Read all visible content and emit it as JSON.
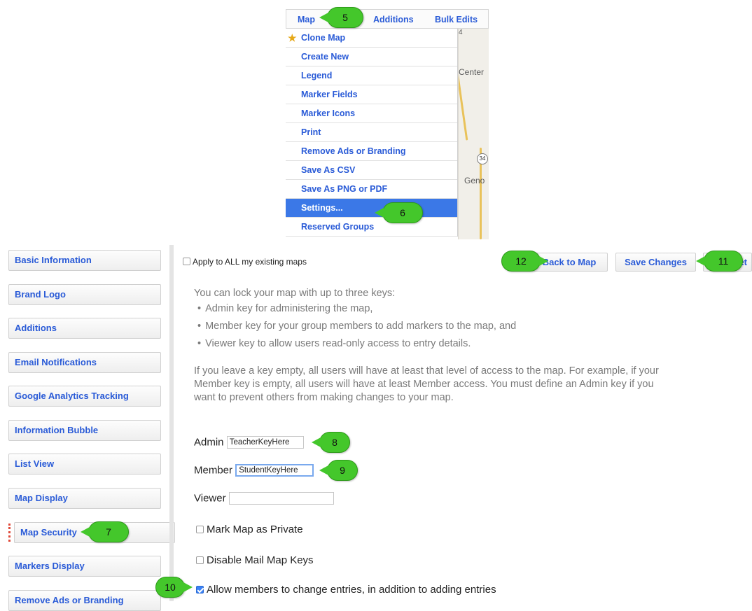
{
  "top_menu": {
    "tabs": [
      "Map",
      "Additions",
      "Bulk Edits"
    ],
    "items": [
      {
        "label": "Clone Map",
        "icon": "star-icon"
      },
      {
        "label": "Create New"
      },
      {
        "label": "Legend"
      },
      {
        "label": "Marker Fields"
      },
      {
        "label": "Marker Icons"
      },
      {
        "label": "Print"
      },
      {
        "label": "Remove Ads or Branding"
      },
      {
        "label": "Save As CSV"
      },
      {
        "label": "Save As PNG or PDF"
      },
      {
        "label": "Settings...",
        "selected": true
      },
      {
        "label": "Reserved Groups"
      }
    ],
    "map_labels": {
      "center": "Center",
      "geno": "Geno",
      "route_top": "4",
      "route_mid": "34"
    }
  },
  "sidebar": {
    "items": [
      {
        "label": "Basic Information"
      },
      {
        "label": "Brand Logo"
      },
      {
        "label": "Additions"
      },
      {
        "label": "Email Notifications"
      },
      {
        "label": "Google Analytics Tracking"
      },
      {
        "label": "Information Bubble"
      },
      {
        "label": "List View"
      },
      {
        "label": "Map Display"
      },
      {
        "label": "Map Security",
        "active": true
      },
      {
        "label": "Markers Display"
      },
      {
        "label": "Remove Ads or Branding"
      }
    ]
  },
  "main": {
    "apply_all_label": "Apply to ALL my existing maps",
    "back_to_map_label": "Back to Map",
    "save_changes_label": "Save Changes",
    "reset_label_partial": "et",
    "intro": "You can lock your map with up to three keys:",
    "bullets": [
      "Admin key for administering the map,",
      "Member key for your group members to add markers to the map, and",
      "Viewer key to allow users read-only access to entry details."
    ],
    "explanation": "If you leave a key empty, all users will have at least that level of access to the map. For example, if your Member key is empty, all users will have at least Member access. You must define an Admin key if you want to prevent others from making changes to your map.",
    "admin_label": "Admin",
    "admin_value": "TeacherKeyHere",
    "member_label": "Member",
    "member_value": "StudentKeyHere",
    "viewer_label": "Viewer",
    "viewer_value": "",
    "private_label": "Mark Map as Private",
    "private_checked": false,
    "disable_mail_label": "Disable Mail Map Keys",
    "disable_mail_checked": false,
    "allow_change_label": "Allow members to change entries, in addition to adding entries",
    "allow_change_checked": true
  },
  "callouts": [
    "5",
    "6",
    "7",
    "8",
    "9",
    "10",
    "11",
    "12"
  ],
  "colors": {
    "link": "#2a5bd7",
    "selected": "#3b78e7",
    "callout": "#44c72b",
    "active_dots": "#e04a3a"
  }
}
